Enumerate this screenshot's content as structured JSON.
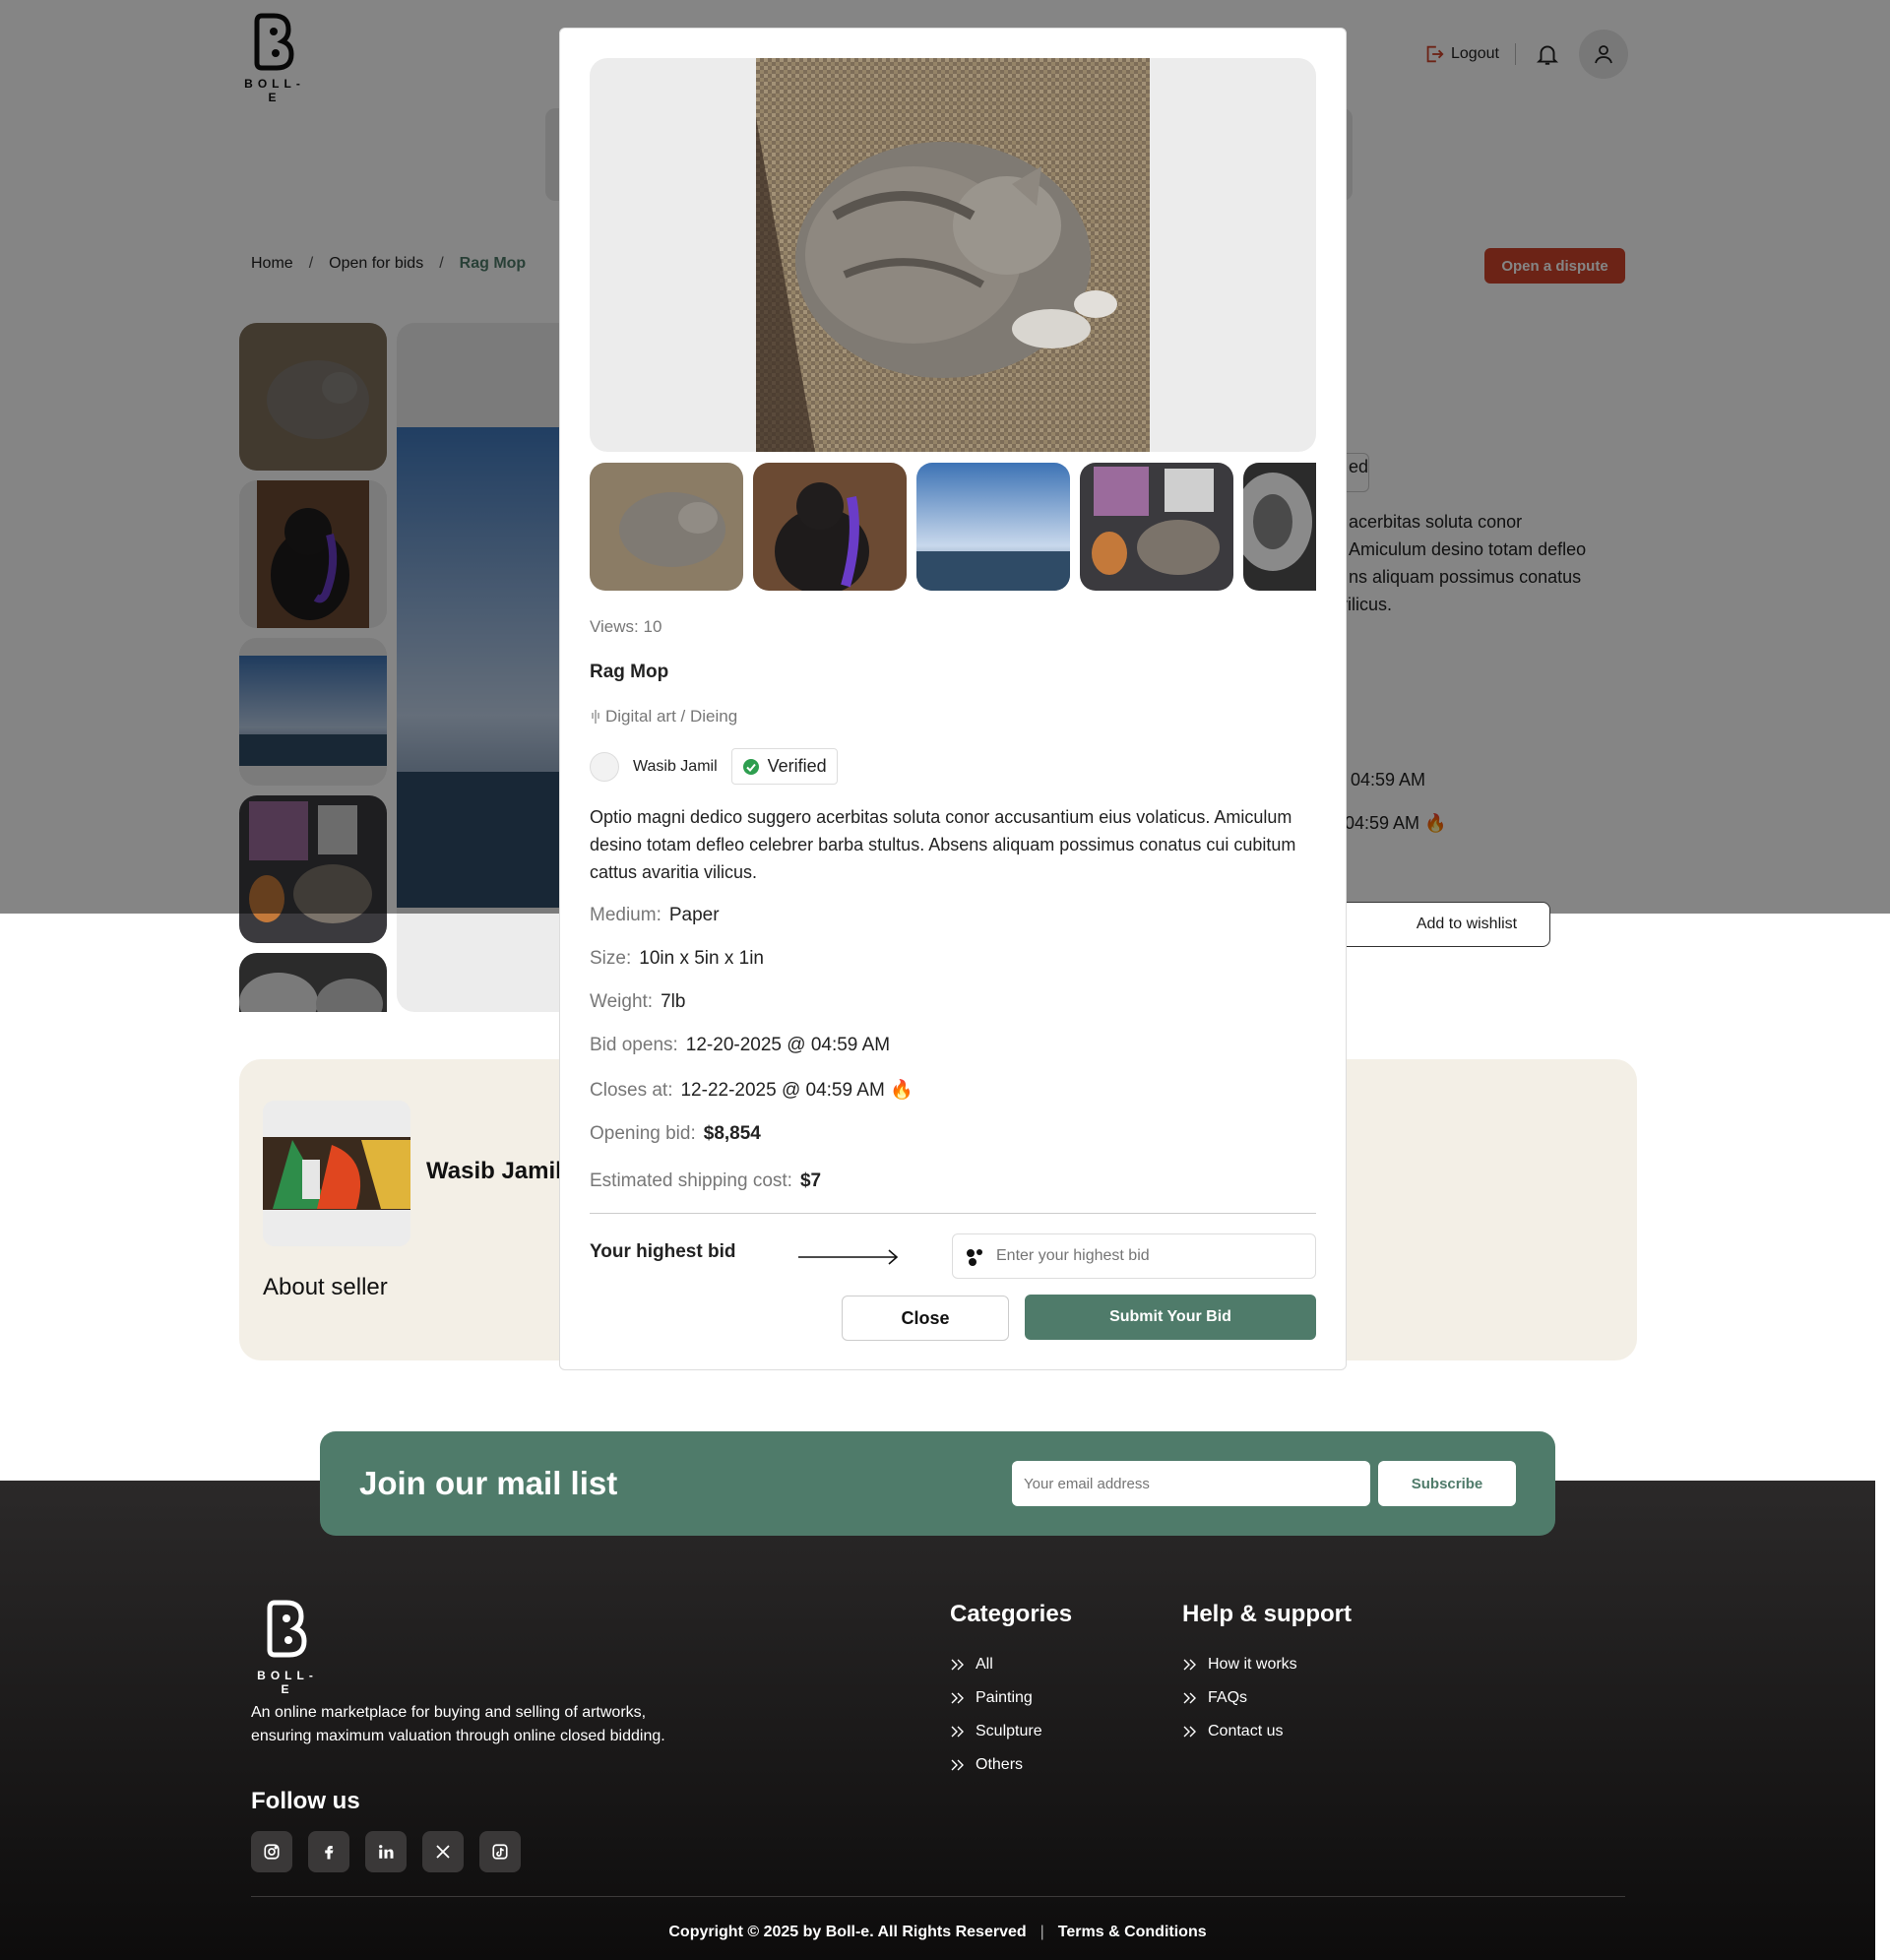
{
  "brand": {
    "logo_text": "BOLL-E"
  },
  "header": {
    "logout_label": "Logout"
  },
  "breadcrumb": {
    "home": "Home",
    "sep": "/",
    "section": "Open for bids",
    "current": "Rag Mop"
  },
  "dispute_label": "Open a dispute",
  "background_text": {
    "tag_fragment": "ed",
    "desc_fragment_1": "acerbitas soluta conor",
    "desc_fragment_2": "Amiculum desino totam defleo",
    "desc_fragment_3": "ns aliquam possimus conatus",
    "desc_fragment_4": "vilicus.",
    "opens_fragment": "04:59 AM",
    "closes_fragment": "04:59 AM 🔥",
    "wishlist_label": "Add to wishlist"
  },
  "seller_card": {
    "name": "Wasib Jamil",
    "about_title": "About seller"
  },
  "modal": {
    "views": "Views: 10",
    "title": "Rag Mop",
    "category": "Digital art / Dieing",
    "seller_name": "Wasib Jamil",
    "verified_label": "Verified",
    "description": "Optio magni dedico suggero acerbitas soluta conor accusantium eius volaticus. Amiculum desino totam defleo celebrer barba stultus. Absens aliquam possimus conatus cui cubitum cattus avaritia vilicus.",
    "details": [
      {
        "label": "Medium:",
        "value": "Paper"
      },
      {
        "label": "Size:",
        "value": "10in x 5in x 1in"
      },
      {
        "label": "Weight:",
        "value": "7lb"
      },
      {
        "label": "Bid opens:",
        "value": "12-20-2025 @ 04:59 AM"
      },
      {
        "label": "Closes at:",
        "value": "12-22-2025 @ 04:59 AM 🔥"
      },
      {
        "label": "Opening bid:",
        "value": "$8,854"
      },
      {
        "label": "Estimated shipping cost:",
        "value": "$7"
      }
    ],
    "bid_label": "Your highest bid",
    "bid_placeholder": "Enter your highest bid",
    "close_label": "Close",
    "submit_label": "Submit Your Bid"
  },
  "mail_list": {
    "title": "Join our mail list",
    "placeholder": "Your email address",
    "subscribe_label": "Subscribe"
  },
  "footer": {
    "description": "An online marketplace for buying and selling of artworks, ensuring maximum valuation through online closed bidding.",
    "follow_title": "Follow us",
    "categories_title": "Categories",
    "categories": [
      "All",
      "Painting",
      "Sculpture",
      "Others"
    ],
    "help_title": "Help & support",
    "help": [
      "How it works",
      "FAQs",
      "Contact us"
    ],
    "copyright": "Copyright © 2025 by Boll-e. All Rights Reserved",
    "separator": "|",
    "terms": "Terms & Conditions"
  },
  "colors": {
    "accent_green": "#4f7b6a",
    "dispute_red": "#d0442b",
    "seller_card_bg": "#f3efe6"
  },
  "icons": [
    "logo-mark",
    "logout-icon",
    "bell-icon",
    "user-icon",
    "category-icon",
    "verified-check-icon",
    "arrow-right-icon",
    "bid-icon",
    "instagram-icon",
    "facebook-icon",
    "linkedin-icon",
    "x-icon",
    "tiktok-icon",
    "double-chevron-icon"
  ]
}
